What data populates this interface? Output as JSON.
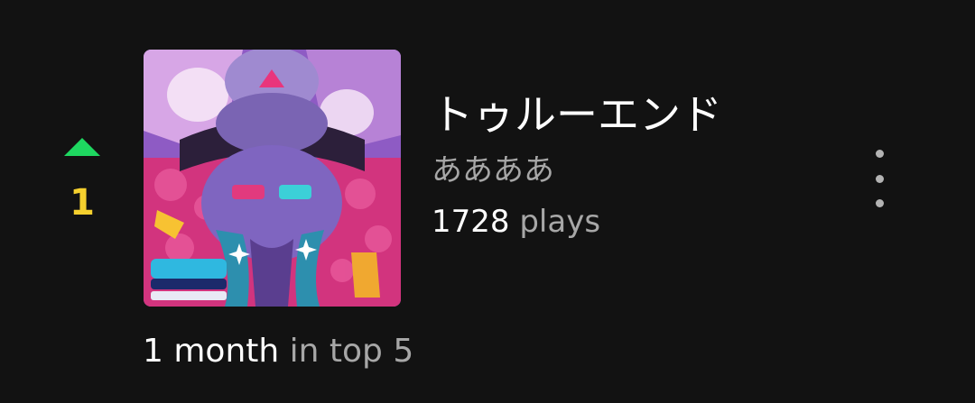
{
  "track": {
    "rank": "1",
    "rank_trend": "up",
    "title": "トゥルーエンド",
    "artist": "ああああ",
    "play_count": "1728",
    "plays_label": "plays",
    "duration_amount": "1 month",
    "duration_suffix": "in top 5"
  },
  "icons": {
    "rank_trend": "triangle-up-icon",
    "menu": "more-vertical-icon"
  },
  "colors": {
    "background": "#121212",
    "rank_up": "#1ed760",
    "rank_number": "#f5d02e",
    "primary_text": "#ffffff",
    "secondary_text": "#a7a7a7"
  }
}
